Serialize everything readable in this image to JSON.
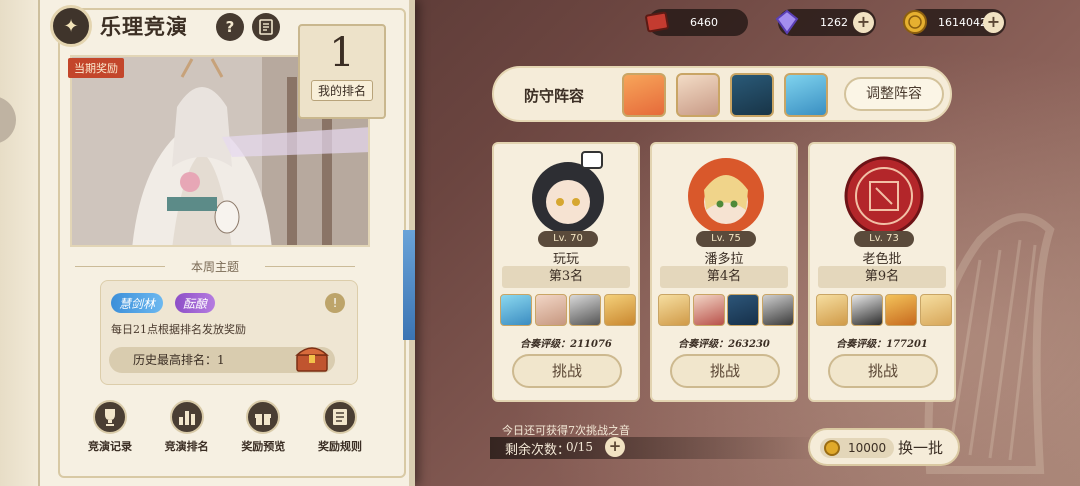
{
  "header": {
    "title": "乐理竞演",
    "help_label": "?",
    "notes_icon": "document-icon"
  },
  "currency": [
    {
      "name": "ticket",
      "icon": "red-card-icon",
      "value": "6460",
      "has_plus": false
    },
    {
      "name": "diamond",
      "icon": "purple-gem-icon",
      "value": "1262",
      "has_plus": true
    },
    {
      "name": "coin",
      "icon": "gold-coin-icon",
      "value": "1614042",
      "has_plus": true
    }
  ],
  "left_panel": {
    "reward_tag": "当期奖励",
    "my_rank": {
      "value": "1",
      "label": "我的排名"
    },
    "theme_heading": "本周主题",
    "tags": [
      "慧剑林",
      "酝酿"
    ],
    "daily_note": "每日21点根据排名发放奖励",
    "history_best": "历史最高排名：1",
    "menu": [
      {
        "label": "竞演记录",
        "icon": "trophy-icon"
      },
      {
        "label": "竞演排名",
        "icon": "bar-chart-icon"
      },
      {
        "label": "奖励预览",
        "icon": "gift-icon"
      },
      {
        "label": "奖励规则",
        "icon": "rules-list-icon"
      }
    ]
  },
  "defense": {
    "label": "防守阵容",
    "adjust_label": "调整阵容"
  },
  "opponents": [
    {
      "level": "Lv. 70",
      "name": "玩玩",
      "rank": "第3名",
      "score": "合奏评级：211076",
      "button": "挑战"
    },
    {
      "level": "Lv. 75",
      "name": "潘多拉",
      "rank": "第4名",
      "score": "合奏评级：263230",
      "button": "挑战"
    },
    {
      "level": "Lv. 73",
      "name": "老色批",
      "rank": "第9名",
      "score": "合奏评级：177201",
      "button": "挑战"
    }
  ],
  "bottom": {
    "today_note": "今日还可获得7次挑战之音",
    "remaining_label": "剩余次数：",
    "remaining_value": "0/15",
    "refresh_cost": "10000",
    "refresh_label": "换一批"
  },
  "colors": {
    "accent_red": "#c3462b",
    "gold": "#e0a92a",
    "cream": "#f6eedd"
  }
}
